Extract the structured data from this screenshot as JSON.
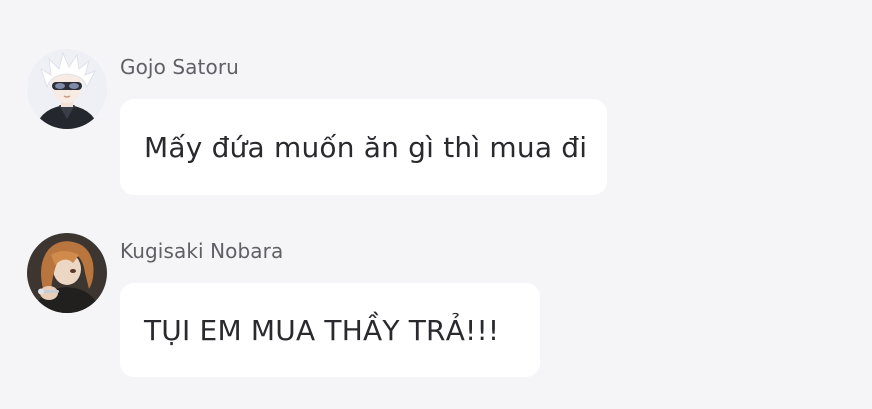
{
  "messages": [
    {
      "sender": "Gojo Satoru",
      "text": "Mấy đứa muốn ăn gì thì mua đi",
      "avatar_icon": "white-haired-person-avatar"
    },
    {
      "sender": "Kugisaki Nobara",
      "text": "TỤI EM MUA THẦY TRẢ!!!",
      "avatar_icon": "brown-haired-person-avatar"
    }
  ],
  "colors": {
    "background": "#f5f5f7",
    "bubble": "#ffffff",
    "sender_text": "#5f5f66",
    "message_text": "#2a2a2e"
  }
}
